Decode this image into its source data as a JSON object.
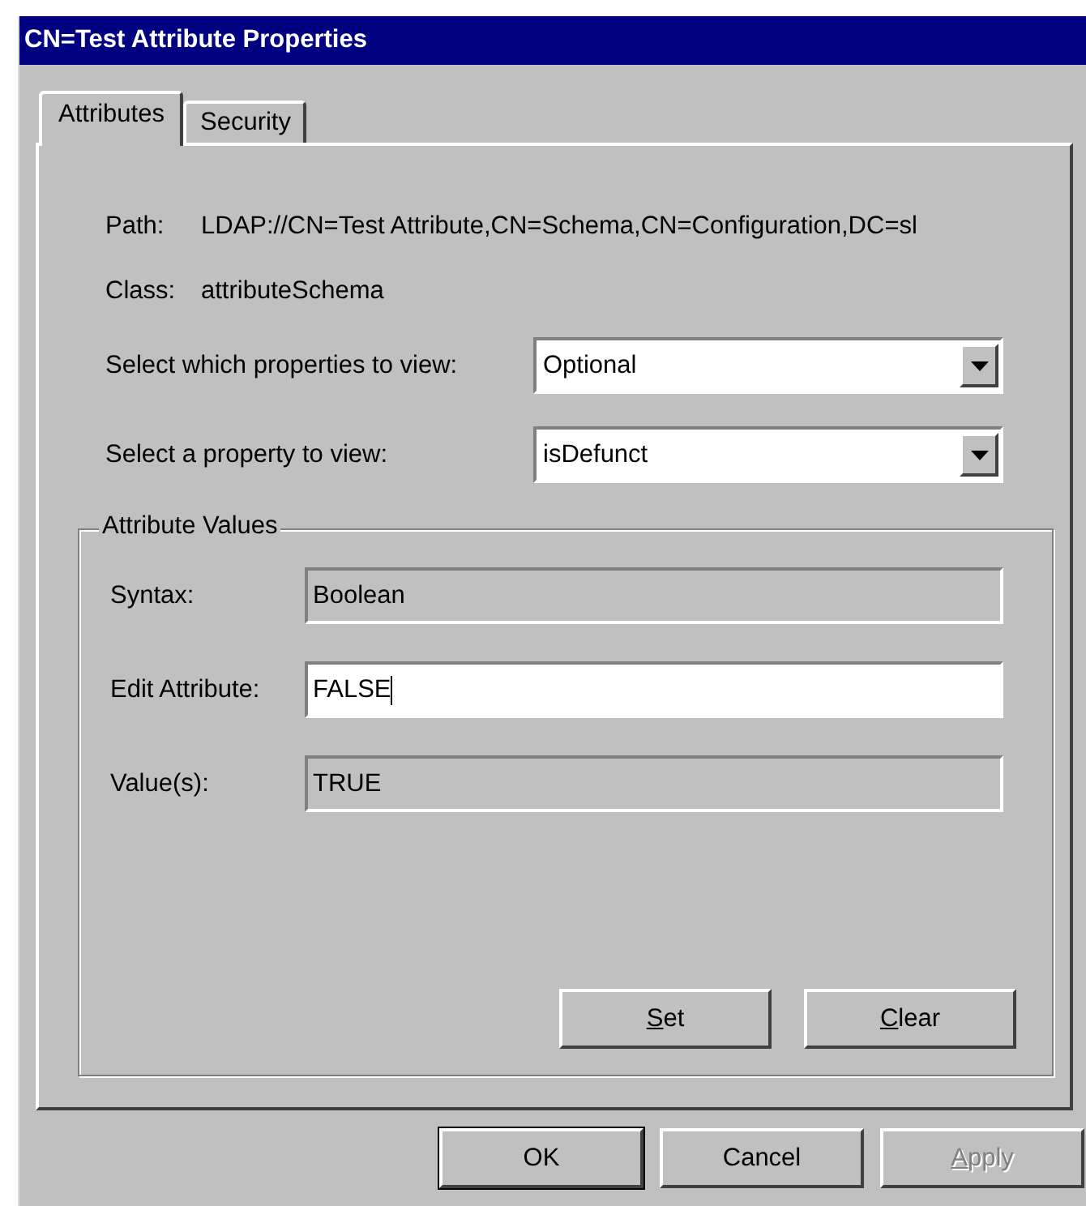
{
  "window": {
    "title": "CN=Test Attribute Properties"
  },
  "tabs": [
    {
      "label": "Attributes",
      "selected": true
    },
    {
      "label": "Security",
      "selected": false
    }
  ],
  "info": [
    {
      "label": "Path:",
      "value": "LDAP://CN=Test Attribute,CN=Schema,CN=Configuration,DC=sl"
    },
    {
      "label": "Class:",
      "value": "attributeSchema"
    }
  ],
  "dropdowns": [
    {
      "label": "Select which properties to view:",
      "value": "Optional"
    },
    {
      "label": "Select a property to view:",
      "value": "isDefunct"
    }
  ],
  "attribute_values": {
    "title": "Attribute Values",
    "fields": [
      {
        "label": "Syntax:",
        "value": "Boolean",
        "editable": false,
        "focused": false
      },
      {
        "label": "Edit Attribute:",
        "value": "FALSE",
        "editable": true,
        "focused": true
      },
      {
        "label": "Value(s):",
        "value": "TRUE",
        "editable": false,
        "focused": false
      }
    ],
    "buttons": [
      {
        "label": "Set",
        "first_letter_underlined": true
      },
      {
        "label": "Clear",
        "first_letter_underlined": true
      }
    ]
  },
  "buttons": [
    {
      "label": "OK",
      "default": true,
      "disabled": false
    },
    {
      "label": "Cancel",
      "default": false,
      "disabled": false
    },
    {
      "label": "Apply",
      "first_letter_underlined": true,
      "default": false,
      "disabled": true
    }
  ]
}
